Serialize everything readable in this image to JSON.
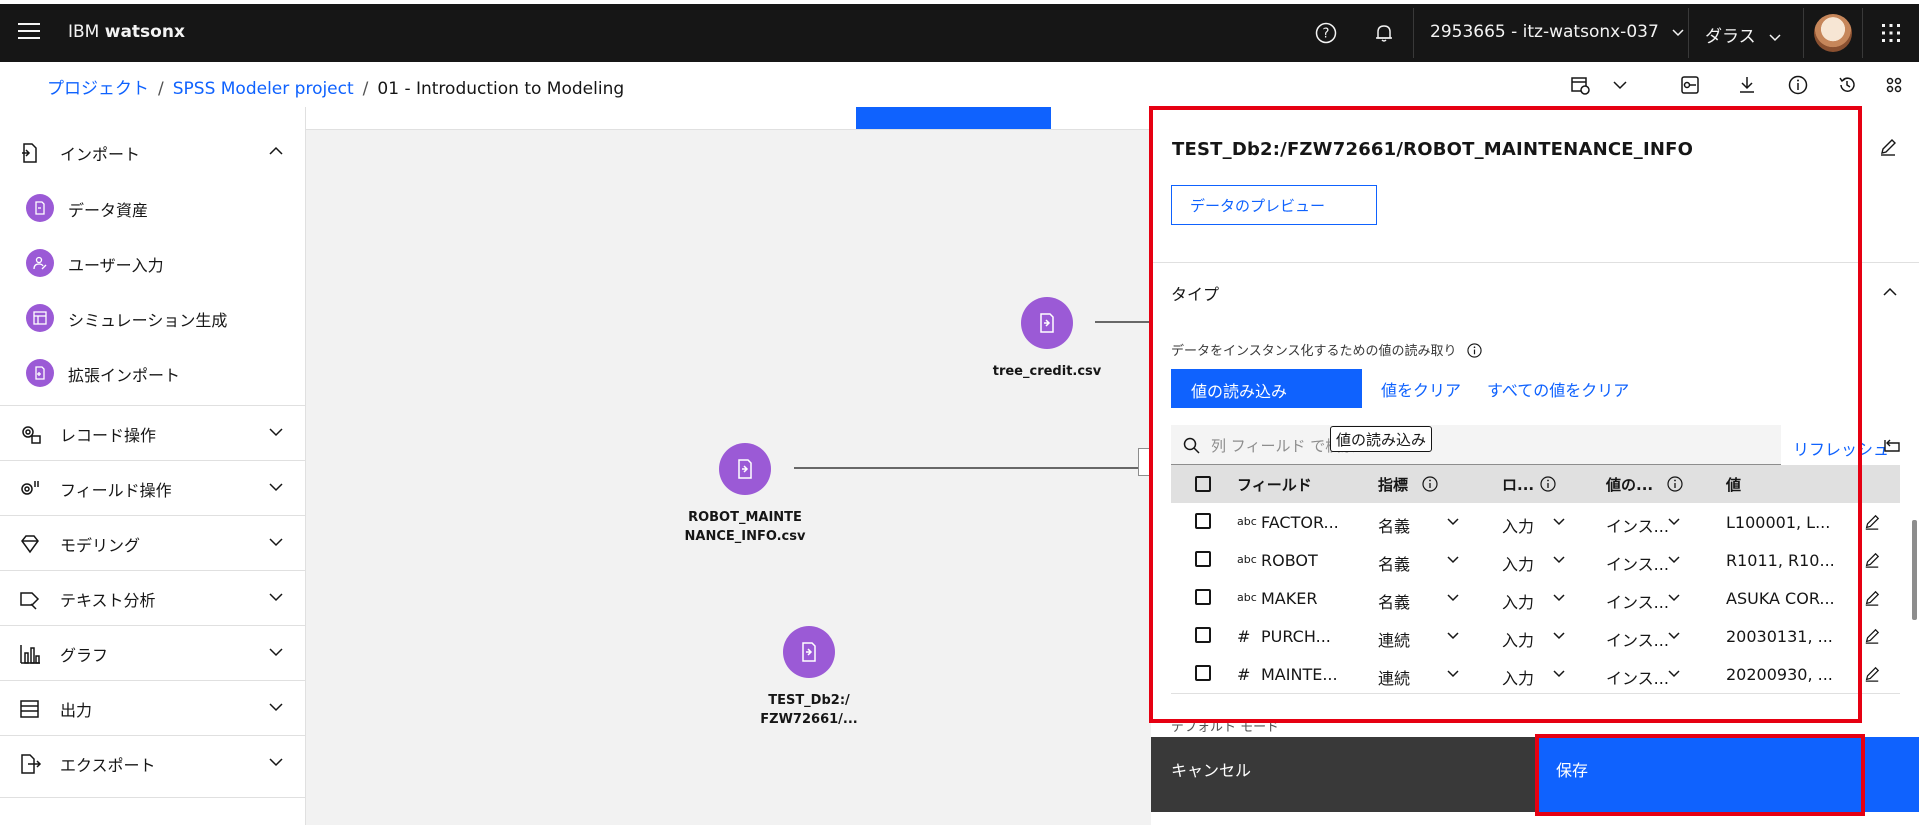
{
  "header": {
    "brand_prefix": "IBM",
    "brand_name": "watsonx",
    "account": "2953665 - itz-watsonx-037",
    "region": "ダラス"
  },
  "breadcrumb": {
    "items": [
      "プロジェクト",
      "SPSS Modeler project"
    ],
    "current": "01 - Introduction to Modeling"
  },
  "sidebar": {
    "categories": [
      {
        "label": "インポート",
        "icon": "import-icon",
        "expanded": true
      },
      {
        "label": "レコード操作",
        "icon": "record-ops-icon"
      },
      {
        "label": "フィールド操作",
        "icon": "field-ops-icon"
      },
      {
        "label": "モデリング",
        "icon": "modeling-icon"
      },
      {
        "label": "テキスト分析",
        "icon": "text-analysis-icon"
      },
      {
        "label": "グラフ",
        "icon": "graph-icon"
      },
      {
        "label": "出力",
        "icon": "output-icon"
      },
      {
        "label": "エクスポート",
        "icon": "export-icon"
      }
    ],
    "import_items": [
      "データ資産",
      "ユーザー入力",
      "シミュレーション生成",
      "拡張インポート"
    ]
  },
  "canvas": {
    "nodes": [
      {
        "label": "tree_credit.csv"
      },
      {
        "label_line1": "ROBOT_MAINTE",
        "label_line2": "NANCE_INFO.csv"
      },
      {
        "label_line1": "TEST_Db2:/",
        "label_line2": "FZW72661/..."
      }
    ]
  },
  "panel": {
    "asset_title": "TEST_Db2:/FZW72661/ROBOT_MAINTENANCE_INFO",
    "preview_button": "データのプレビュー",
    "type_section": "タイプ",
    "read_caption": "データをインスタンス化するための値の読み取り",
    "read_values_button": "値の読み込み",
    "clear_values_link": "値をクリア",
    "clear_all_link": "すべての値をクリア",
    "search_placeholder": "列 フィールド で検索",
    "tooltip": "値の読み込み",
    "refresh": "リフレッシュ",
    "columns": {
      "field": "フィールド",
      "measure": "指標",
      "role": "ロ...",
      "values": "値の...",
      "value": "値"
    },
    "rows": [
      {
        "type": "abc",
        "field": "FACTOR...",
        "measure": "名義",
        "role": "入力",
        "values": "インス...",
        "value": "L100001, L..."
      },
      {
        "type": "abc",
        "field": "ROBOT",
        "measure": "名義",
        "role": "入力",
        "values": "インス...",
        "value": "R1011, R10..."
      },
      {
        "type": "abc",
        "field": "MAKER",
        "measure": "名義",
        "role": "入力",
        "values": "インス...",
        "value": "ASUKA COR..."
      },
      {
        "type": "#",
        "field": "PURCH...",
        "measure": "連続",
        "role": "入力",
        "values": "インス...",
        "value": "20030131, ..."
      },
      {
        "type": "#",
        "field": "MAINTE...",
        "measure": "連続",
        "role": "入力",
        "values": "インス...",
        "value": "20200930, ..."
      }
    ],
    "default_mode": "デフォルト モード",
    "cancel": "キャンセル",
    "save": "保存"
  },
  "colors": {
    "accent": "#0f62fe",
    "node": "#9b5ad6",
    "highlight": "#e60012"
  }
}
